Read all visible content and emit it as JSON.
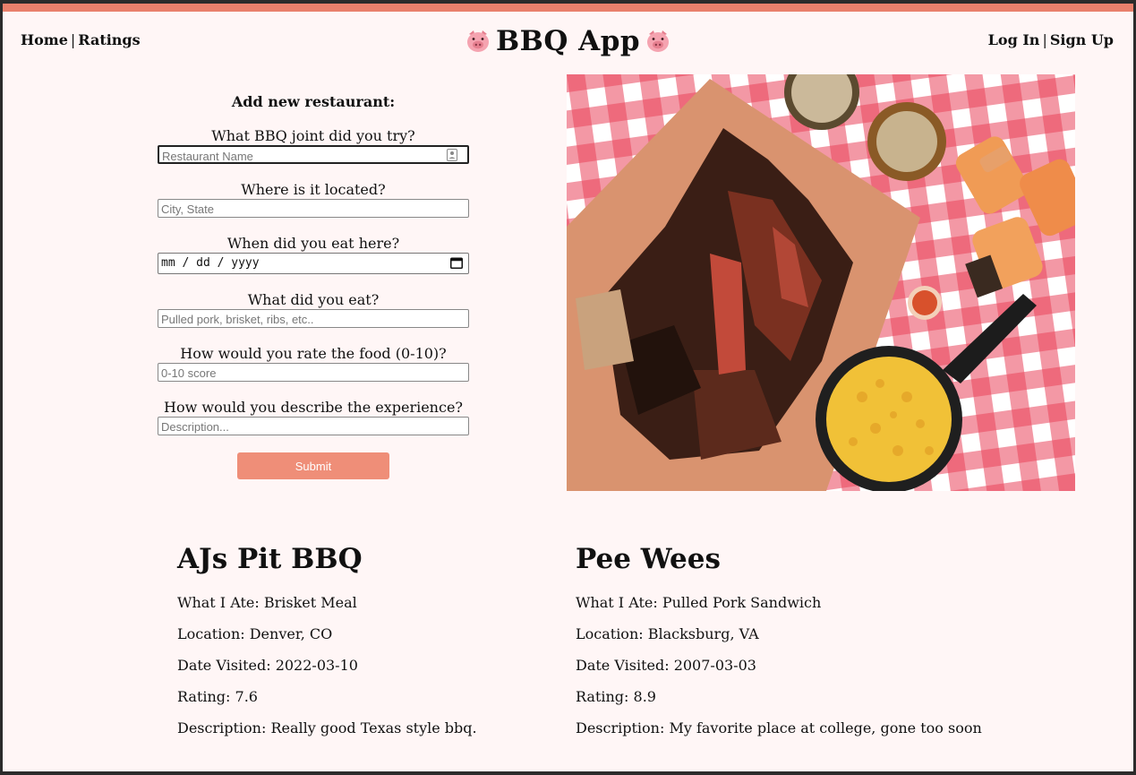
{
  "nav": {
    "home": "Home",
    "ratings": "Ratings",
    "separator": "|",
    "brand": "BBQ App",
    "login": "Log In",
    "signup": "Sign Up",
    "brand_icon": "pig-face-icon"
  },
  "form": {
    "title": "Add new restaurant:",
    "fields": [
      {
        "question": "What BBQ joint did you try?",
        "placeholder": "Restaurant Name",
        "value": ""
      },
      {
        "question": "Where is it located?",
        "placeholder": "City, State",
        "value": ""
      },
      {
        "question": "When did you eat here?",
        "placeholder": "mm / dd / yyyy",
        "value": ""
      },
      {
        "question": "What did you eat?",
        "placeholder": "Pulled pork, brisket, ribs, etc..",
        "value": ""
      },
      {
        "question": "How would you rate the food (0-10)?",
        "placeholder": "0-10 score",
        "value": ""
      },
      {
        "question": "How would you describe the experience?",
        "placeholder": "Description...",
        "value": ""
      }
    ],
    "submit_label": "Submit"
  },
  "colors": {
    "accent": "#e9806c",
    "button": "#ef8e78",
    "background": "#fff6f6"
  },
  "ratings": [
    {
      "name": "AJs Pit BBQ",
      "ate": "What I Ate: Brisket Meal",
      "location": "Location: Denver, CO",
      "date": "Date Visited: 2022-03-10",
      "rating": "Rating: 7.6",
      "description": "Description: Really good Texas style bbq."
    },
    {
      "name": "Pee Wees",
      "ate": "What I Ate: Pulled Pork Sandwich",
      "location": "Location: Blacksburg, VA",
      "date": "Date Visited: 2007-03-03",
      "rating": "Rating: 8.9",
      "description": "Description: My favorite place at college, gone too soon"
    }
  ]
}
